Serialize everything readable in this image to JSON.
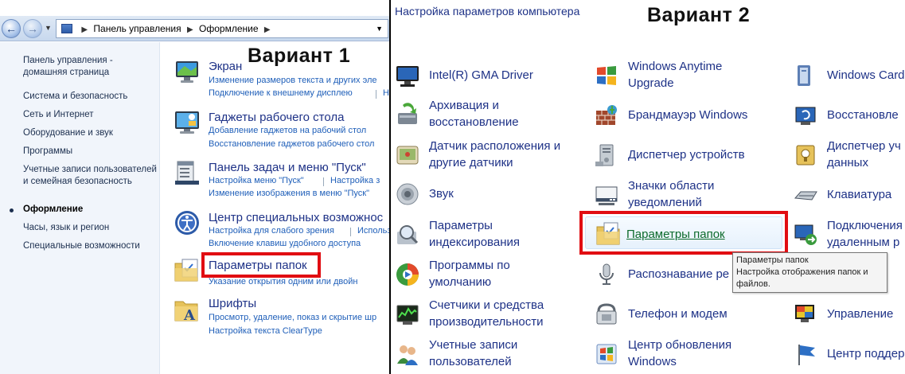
{
  "variant1": {
    "title": "Вариант 1",
    "breadcrumb": [
      "Панель управления",
      "Оформление"
    ],
    "sidebar": {
      "home": "Панель управления - домашняя страница",
      "items": [
        "Система и безопасность",
        "Сеть и Интернет",
        "Оборудование и звук",
        "Программы",
        "Учетные записи пользователей и семейная безопасность",
        "Оформление",
        "Часы, язык и регион",
        "Специальные возможности"
      ]
    },
    "categories": [
      {
        "title": "Экран",
        "icon": "display-icon",
        "links": [
          "Изменение размеров текста и других эле",
          "Подключение к внешнему дисплею",
          "Н"
        ]
      },
      {
        "title": "Гаджеты рабочего стола",
        "icon": "gadgets-icon",
        "links": [
          "Добавление гаджетов на рабочий стол",
          "Восстановление гаджетов рабочего стол"
        ]
      },
      {
        "title": "Панель задач и меню \"Пуск\"",
        "icon": "taskbar-icon",
        "links": [
          "Настройка меню \"Пуск\"",
          "Настройка з",
          "Изменение изображения в меню \"Пуск\""
        ]
      },
      {
        "title": "Центр специальных возможнос",
        "icon": "ease-of-access-icon",
        "links": [
          "Настройка для слабого зрения",
          "Использ",
          "Включение клавиш удобного доступа"
        ]
      },
      {
        "title": "Параметры папок",
        "icon": "folder-options-icon",
        "links": [
          "Указание открытия одним или двойн"
        ]
      },
      {
        "title": "Шрифты",
        "icon": "fonts-icon",
        "links": [
          "Просмотр, удаление, показ и скрытие шр",
          "Настройка текста ClearType"
        ]
      }
    ]
  },
  "variant2": {
    "title": "Вариант 2",
    "header": "Настройка параметров компьютера",
    "items": [
      {
        "label": "Intel(R) GMA Driver",
        "icon": "monitor-icon"
      },
      {
        "label": "Архивация и восстановление",
        "icon": "backup-icon"
      },
      {
        "label": "Датчик расположения и другие датчики",
        "icon": "sensor-icon"
      },
      {
        "label": "Звук",
        "icon": "speaker-icon"
      },
      {
        "label": "Параметры индексирования",
        "icon": "indexing-icon"
      },
      {
        "label": "Программы по умолчанию",
        "icon": "default-programs-icon"
      },
      {
        "label": "Счетчики и средства производительности",
        "icon": "performance-icon"
      },
      {
        "label": "Учетные записи пользователей",
        "icon": "users-icon"
      },
      {
        "label": "Windows Anytime Upgrade",
        "icon": "windows-flag-icon"
      },
      {
        "label": "Брандмауэр Windows",
        "icon": "firewall-icon"
      },
      {
        "label": "Диспетчер устройств",
        "icon": "device-manager-icon"
      },
      {
        "label": "Значки области уведомлений",
        "icon": "notification-icons-icon"
      },
      {
        "label": "Параметры папок",
        "icon": "folder-options-icon"
      },
      {
        "label": "Распознавание ре",
        "icon": "microphone-icon"
      },
      {
        "label": "Телефон и модем",
        "icon": "phone-icon"
      },
      {
        "label": "Центр обновления Windows",
        "icon": "windows-update-icon"
      },
      {
        "label": "Windows Card",
        "icon": "cardspace-icon"
      },
      {
        "label": "Восстановле",
        "icon": "recovery-icon"
      },
      {
        "label": "Диспетчер уч данных",
        "icon": "credential-manager-icon"
      },
      {
        "label": "Клавиатура",
        "icon": "keyboard-icon"
      },
      {
        "label": "Подключения удаленным р",
        "icon": "remote-icon"
      },
      {
        "label": "Управление",
        "icon": "color-management-icon"
      },
      {
        "label": "Центр поддер",
        "icon": "action-center-icon"
      }
    ],
    "tooltip": {
      "title": "Параметры папок",
      "text": "Настройка отображения папок и файлов."
    }
  }
}
